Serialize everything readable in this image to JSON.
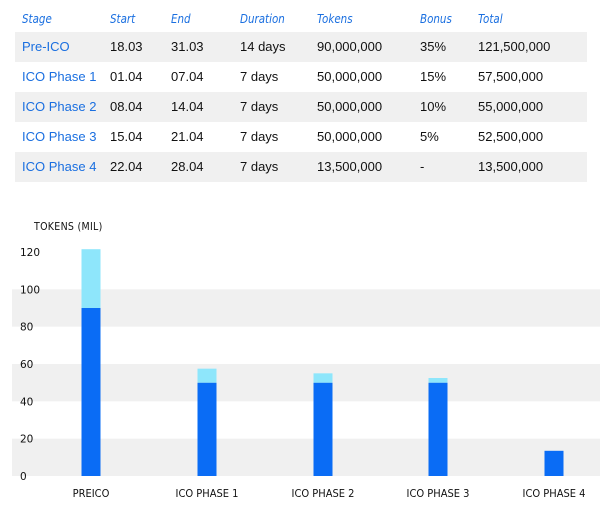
{
  "table": {
    "headers": [
      "Stage",
      "Start",
      "End",
      "Duration",
      "Tokens",
      "Bonus",
      "Total"
    ],
    "rows": [
      [
        "Pre-ICO",
        "18.03",
        "31.03",
        "14 days",
        "90,000,000",
        "35%",
        "121,500,000"
      ],
      [
        "ICO Phase 1",
        "01.04",
        "07.04",
        "7 days",
        "50,000,000",
        "15%",
        "57,500,000"
      ],
      [
        "ICO Phase 2",
        "08.04",
        "14.04",
        "7 days",
        "50,000,000",
        "10%",
        "55,000,000"
      ],
      [
        "ICO Phase 3",
        "15.04",
        "21.04",
        "7 days",
        "50,000,000",
        "5%",
        "52,500,000"
      ],
      [
        "ICO Phase 4",
        "22.04",
        "28.04",
        "7 days",
        "13,500,000",
        "-",
        "13,500,000"
      ]
    ]
  },
  "colors": {
    "accent": "#1a6fe0",
    "base_bar": "#0a6cf5",
    "bonus_bar": "#8ee6fb",
    "grid_band": "#f0f0f0",
    "row_shade": "#f0f0f0"
  },
  "chart_data": {
    "type": "bar",
    "stacked": true,
    "ylabel": "TOKENS (MIL)",
    "xlabel": "",
    "ylim": [
      0,
      120
    ],
    "yticks": [
      0,
      20,
      40,
      60,
      80,
      100,
      120
    ],
    "categories": [
      "PREICO",
      "ICO PHASE 1",
      "ICO PHASE 2",
      "ICO PHASE 3",
      "ICO PHASE 4"
    ],
    "series": [
      {
        "values": [
          90,
          50,
          50,
          50,
          13.5
        ]
      },
      {
        "values": [
          31.5,
          7.5,
          5,
          2.5,
          0
        ]
      }
    ],
    "grid": true,
    "legend": "none"
  }
}
